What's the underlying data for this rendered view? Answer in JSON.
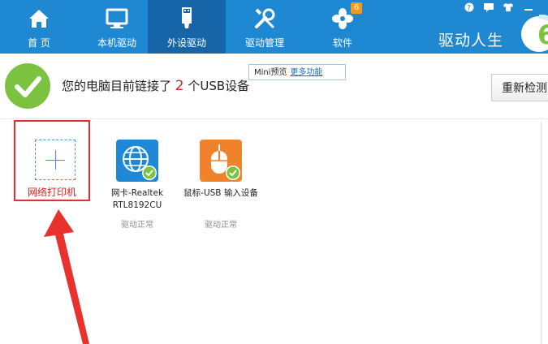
{
  "nav": [
    {
      "id": "home",
      "label": "首 页",
      "icon": "home-icon"
    },
    {
      "id": "local",
      "label": "本机驱动",
      "icon": "monitor-icon"
    },
    {
      "id": "external",
      "label": "外设驱动",
      "icon": "usb-icon",
      "active": true
    },
    {
      "id": "manage",
      "label": "驱动管理",
      "icon": "tools-icon"
    },
    {
      "id": "software",
      "label": "软件",
      "icon": "clover-icon",
      "badge": "6"
    }
  ],
  "brand": {
    "name": "驱动人生",
    "logo_glyph": "6"
  },
  "window_controls": [
    "help-icon",
    "message-icon",
    "shirt-icon",
    "minimize-icon"
  ],
  "status": {
    "prefix": "您的电脑目前链接了 ",
    "count": "2",
    "suffix": " 个USB设备"
  },
  "mini": {
    "label": "Mini预览",
    "more": "更多功能"
  },
  "recheck_label": "重新检测",
  "add_device": {
    "label": "网络打印机"
  },
  "devices": [
    {
      "name_line1": "网卡-Realtek",
      "name_line2": "RTL8192CU",
      "status": "驱动正常",
      "icon": "globe-icon",
      "color": "#1e88d6"
    },
    {
      "name_line1": "鼠标-USB 输入设备",
      "name_line2": "",
      "status": "驱动正常",
      "icon": "mouse-icon",
      "color": "#f0822a"
    }
  ],
  "colors": {
    "topbar": "#1f88d2",
    "active_tab": "#1565a8",
    "ok_green": "#7cc241",
    "alert_red": "#e02020",
    "badge": "#f39a1d"
  }
}
